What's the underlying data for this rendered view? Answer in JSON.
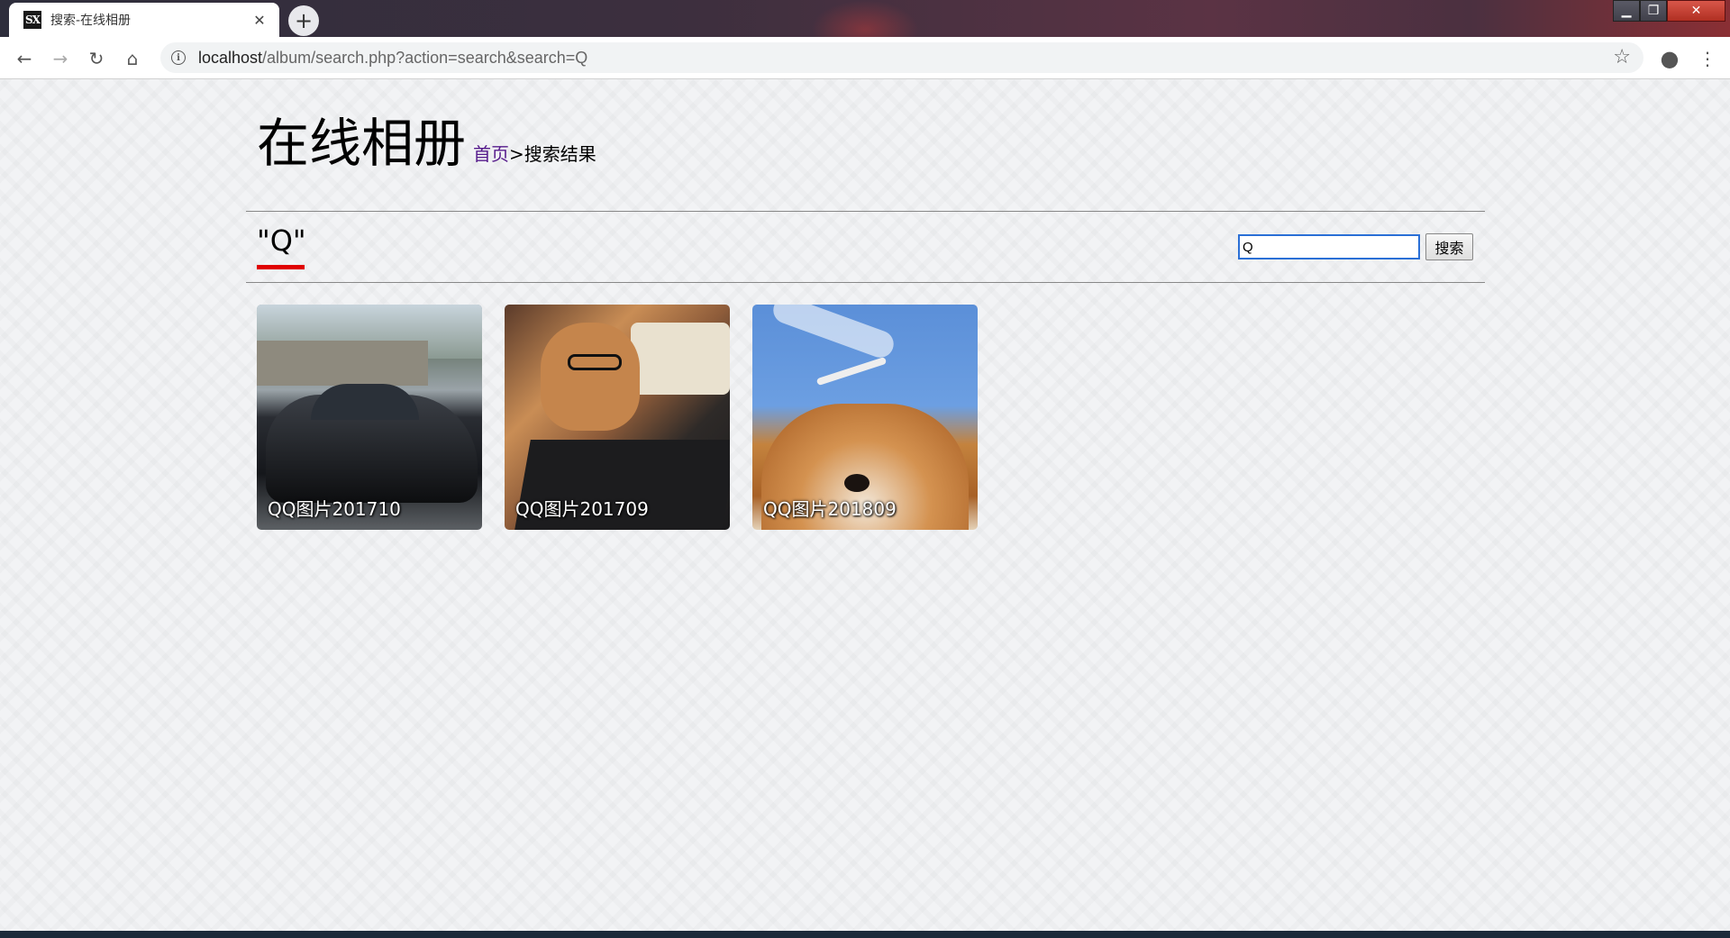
{
  "browser": {
    "tab_title": "搜索-在线相册",
    "favicon_text": "SX",
    "url_host": "localhost",
    "url_path": "/album/search.php?action=search&search=Q"
  },
  "page": {
    "site_title": "在线相册",
    "breadcrumb_home": "首页",
    "breadcrumb_sep": ">",
    "breadcrumb_current": "搜索结果",
    "query_heading": "\"Q\"",
    "search_value": "Q",
    "search_button": "搜索"
  },
  "results": [
    {
      "caption": "QQ图片201710"
    },
    {
      "caption": "QQ图片201709"
    },
    {
      "caption": "QQ图片201809"
    }
  ]
}
